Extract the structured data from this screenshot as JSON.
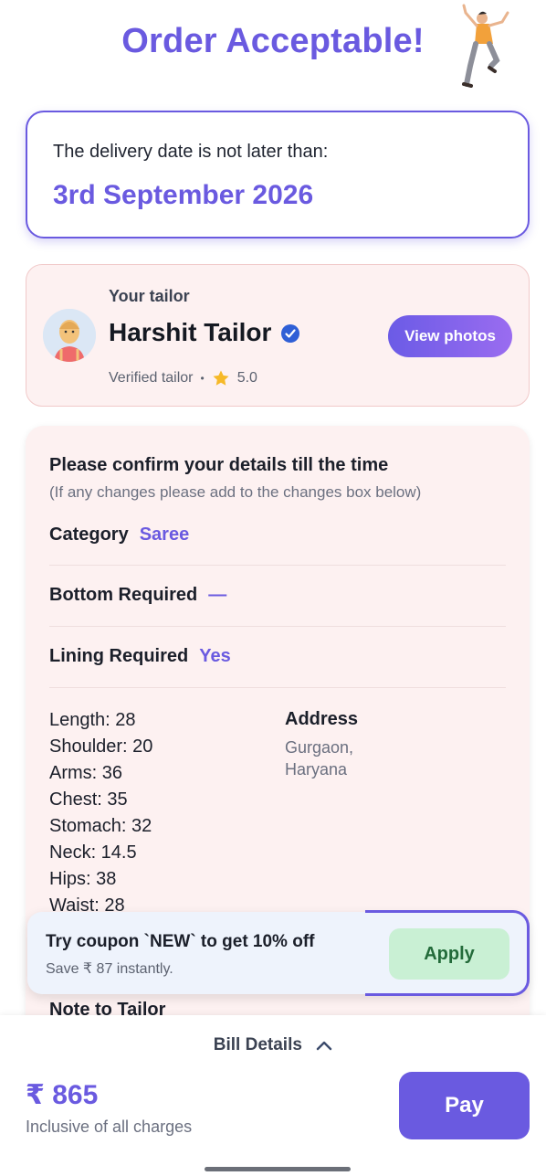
{
  "header": {
    "title": "Order Acceptable!",
    "illustration_icon": "dancing-person-icon"
  },
  "delivery": {
    "label": "The delivery date is not later than:",
    "date": "3rd September 2026"
  },
  "tailor": {
    "section_label": "Your tailor",
    "name": "Harshit Tailor",
    "verified_text": "Verified tailor",
    "separator": "•",
    "rating": "5.0",
    "view_photos_label": "View photos"
  },
  "details": {
    "title": "Please confirm your details till the time",
    "subtitle": "(If any changes please add to the changes box below)",
    "rows": [
      {
        "label": "Category",
        "value": "Saree"
      },
      {
        "label": "Bottom Required",
        "value": "—"
      },
      {
        "label": "Lining Required",
        "value": "Yes"
      }
    ],
    "measurements": [
      "Length: 28",
      "Shoulder: 20",
      "Arms: 36",
      "Chest: 35",
      "Stomach: 32",
      "Neck: 14.5",
      "Hips: 38",
      "Waist: 28"
    ],
    "address_title": "Address",
    "address_text": "Gurgaon, Haryana",
    "note_label": "Note to Tailor"
  },
  "coupon": {
    "title": "Try coupon `NEW` to get 10% off",
    "subtitle": "Save ₹ 87 instantly.",
    "apply_label": "Apply"
  },
  "footer": {
    "bill_details_label": "Bill Details",
    "total": "₹ 865",
    "inclusive_text": "Inclusive of all charges",
    "pay_label": "Pay"
  },
  "colors": {
    "accent": "#6a5ae0",
    "card_pink": "#fdf1f1",
    "apply_green": "#c9f0d4"
  }
}
